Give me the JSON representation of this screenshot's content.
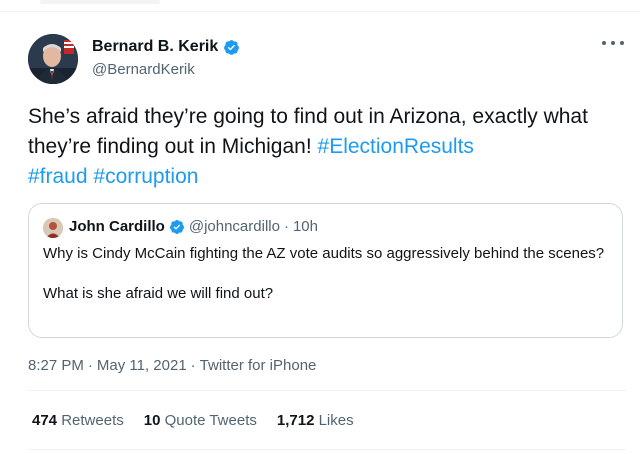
{
  "author": {
    "display_name": "Bernard B. Kerik",
    "handle": "@BernardKerik",
    "verified_icon": "verified-badge-icon",
    "avatar_icon": "profile-photo"
  },
  "more_icon": "more-options-icon",
  "tweet": {
    "text_plain": "She’s afraid they’re going to find out in Arizona, exactly what they’re finding out in Michigan!",
    "hashtags": [
      "#ElectionResults",
      "#fraud",
      "#corruption"
    ]
  },
  "quote": {
    "display_name": "John Cardillo",
    "handle": "@johncardillo",
    "separator": "·",
    "time": "10h",
    "paragraphs": [
      "Why is Cindy McCain fighting the AZ vote audits so aggressively behind the scenes?",
      "What is she afraid we will find out?"
    ]
  },
  "meta": {
    "time": "8:27 PM",
    "separator": "·",
    "date": "May 11, 2021",
    "source": "Twitter for iPhone"
  },
  "stats": {
    "retweets_count": "474",
    "retweets_label": "Retweets",
    "quotes_count": "10",
    "quotes_label": "Quote Tweets",
    "likes_count": "1,712",
    "likes_label": "Likes"
  },
  "colors": {
    "link": "#1d9bf0",
    "secondary_text": "#536471",
    "border": "#cfd9de"
  }
}
